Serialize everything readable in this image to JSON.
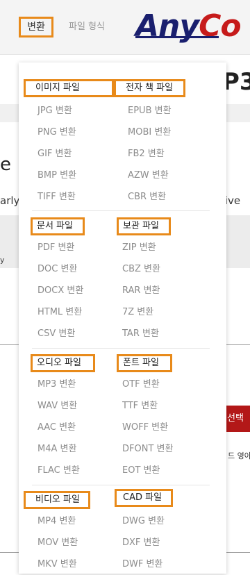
{
  "nav": {
    "convert_label": "변환",
    "format_label": "파일 형식",
    "logo_any": "Any",
    "logo_c": "C",
    "logo_o": "o"
  },
  "background": {
    "heading_fragment": "P3",
    "title_fragment": "e",
    "text_left_fragment": "arly",
    "text_right_fragment": "tive a",
    "band_fragment": "y",
    "select_button": "선택",
    "eng_fragment": "드 영아"
  },
  "menu": {
    "groups": [
      {
        "header": "이미지 파일",
        "items": [
          "JPG 변환",
          "PNG 변환",
          "GIF 변환",
          "BMP 변환",
          "TIFF 변환"
        ]
      },
      {
        "header": "전자 책 파일",
        "items": [
          "EPUB 변환",
          "MOBI 변환",
          "FB2 변환",
          "AZW 변환",
          "CBR 변환"
        ]
      },
      {
        "header": "문서 파일",
        "items": [
          "PDF 변환",
          "DOC 변환",
          "DOCX 변환",
          "HTML 변환",
          "CSV 변환"
        ]
      },
      {
        "header": "보관 파일",
        "items": [
          "ZIP 변환",
          "CBZ 변환",
          "RAR 변환",
          "7Z 변환",
          "TAR 변환"
        ]
      },
      {
        "header": "오디오 파일",
        "items": [
          "MP3 변환",
          "WAV 변환",
          "AAC 변환",
          "M4A 변환",
          "FLAC 변환"
        ]
      },
      {
        "header": "폰트 파일",
        "items": [
          "OTF 변환",
          "TTF 변환",
          "WOFF 변환",
          "DFONT 변환",
          "EOT 변환"
        ]
      },
      {
        "header": "비디오 파일",
        "items": [
          "MP4 변환",
          "MOV 변환",
          "MKV 변환"
        ]
      },
      {
        "header": "CAD 파일",
        "items": [
          "DWG 변환",
          "DXF 변환",
          "DWF 변환"
        ]
      }
    ]
  },
  "colors": {
    "highlight": "#e88a1a",
    "logo_blue": "#1a1f6e",
    "logo_red": "#c61b1b",
    "select_red": "#b31818"
  }
}
